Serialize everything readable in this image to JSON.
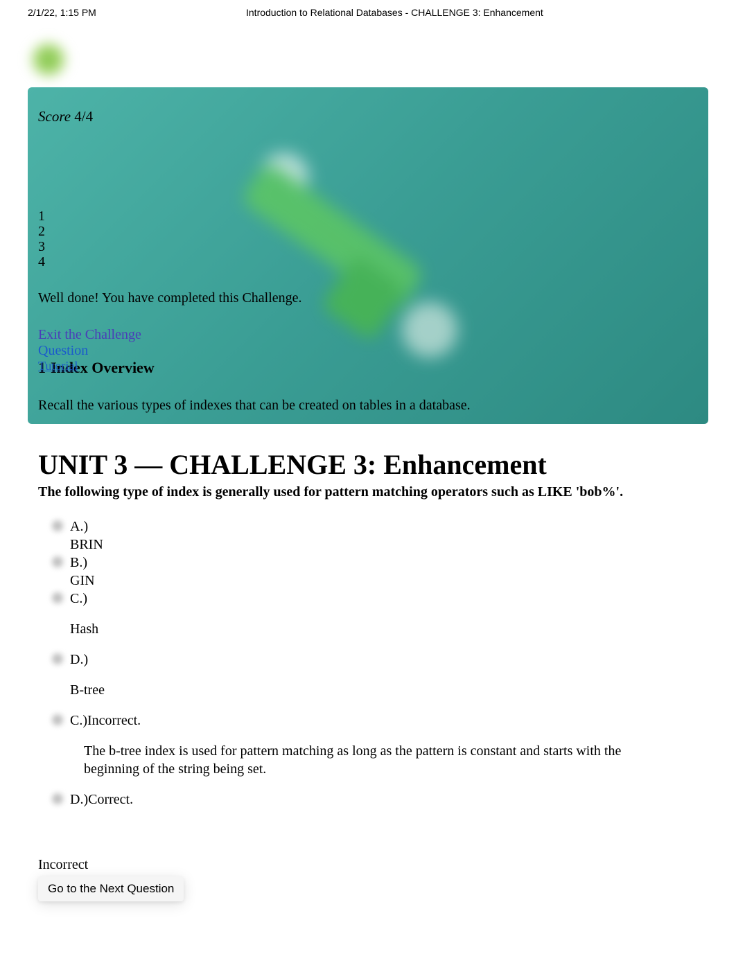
{
  "header": {
    "date": "2/1/22, 1:15 PM",
    "title": "Introduction to Relational Databases - CHALLENGE 3: Enhancement"
  },
  "score": {
    "label": "Score",
    "value": "4/4"
  },
  "nav": [
    "1",
    "2",
    "3",
    "4"
  ],
  "completion_message": "Well done! You have completed this Challenge.",
  "links": {
    "exit": "Exit the Challenge",
    "question": "Question",
    "tutorial": "Tutorial"
  },
  "section": {
    "number": "1",
    "heading": "Index Overview",
    "subtext": "Recall the various types of indexes that can be created on tables in a database."
  },
  "unit_title": "UNIT 3 — CHALLENGE 3: Enhancement",
  "question_text": "The following type of index is generally used for pattern matching operators such as LIKE 'bob%'.",
  "answers": {
    "a": {
      "label": "A.)",
      "text": "BRIN"
    },
    "b": {
      "label": "B.)",
      "text": "GIN"
    },
    "c": {
      "label": "C.)",
      "text": "Hash"
    },
    "d": {
      "label": "D.)",
      "text": "B-tree"
    }
  },
  "feedback": {
    "c": {
      "label": "C.)",
      "status": "Incorrect."
    },
    "explanation": "The b-tree index is used for pattern matching as long as the pattern is constant and starts with the beginning of the string being set.",
    "d": {
      "label": "D.)",
      "status": "Correct."
    }
  },
  "result_label": "Incorrect",
  "next_button": "Go to the Next Question"
}
